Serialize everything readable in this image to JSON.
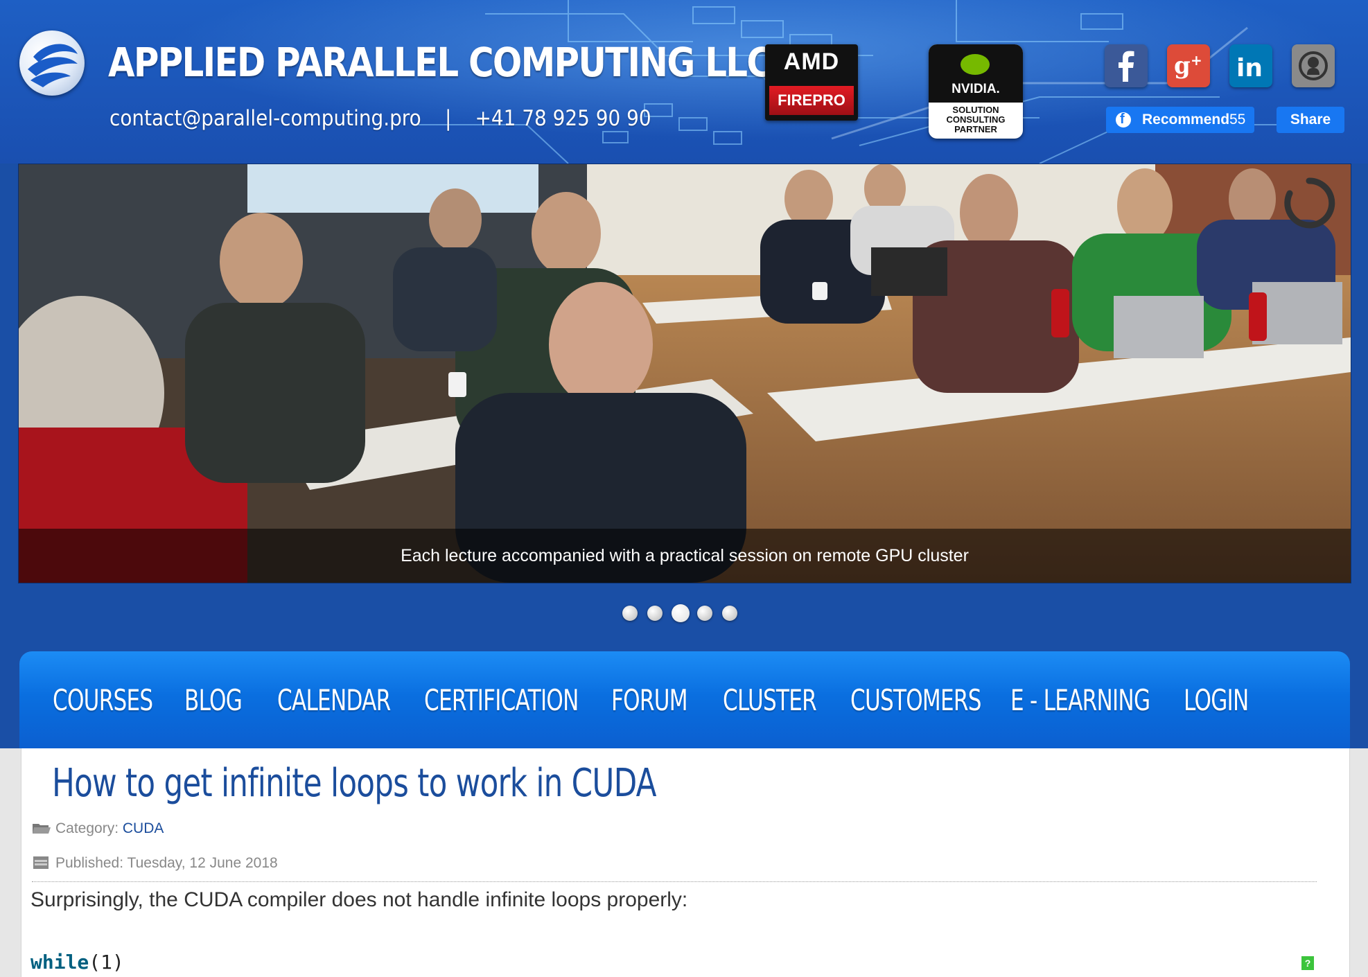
{
  "header": {
    "brand": "APPLIED PARALLEL COMPUTING LLC",
    "email": "contact@parallel-computing.pro",
    "separator": "|",
    "phone": "+41 78 925 90 90",
    "amd_logo": {
      "top": "AMD",
      "bottom": "FIREPRO"
    },
    "nvidia_logo": {
      "name": "NVIDIA.",
      "line1": "SOLUTION",
      "line2": "CONSULTING",
      "line3": "PARTNER"
    },
    "social": [
      {
        "icon": "facebook-icon",
        "color": "#3b5998"
      },
      {
        "icon": "google-plus-icon",
        "color": "#dd4b39"
      },
      {
        "icon": "linkedin-icon",
        "color": "#0077b5"
      },
      {
        "icon": "github-icon",
        "color": "#8a8a8a"
      }
    ],
    "facebook": {
      "recommend_label": "Recommend",
      "recommend_count": "55",
      "share_label": "Share"
    }
  },
  "slider": {
    "caption": "Each lecture accompanied with a practical session on remote GPU cluster",
    "dot_count": 5,
    "active_dot": 3
  },
  "nav": {
    "items": [
      "COURSES",
      "BLOG",
      "CALENDAR",
      "CERTIFICATION",
      "FORUM",
      "CLUSTER",
      "CUSTOMERS",
      "E - LEARNING",
      "LOGIN"
    ]
  },
  "article": {
    "title": "How to get infinite loops to work in CUDA",
    "category_label": "Category:",
    "category_value": "CUDA",
    "published_label": "Published:",
    "published_value": "Tuesday, 12 June 2018",
    "lead": "Surprisingly, the CUDA compiler does not handle infinite loops properly:",
    "code_keyword": "while",
    "code_rest": "(1)",
    "help_badge": "?"
  },
  "colors": {
    "header_blue": "#1e5fc4",
    "nav_blue": "#0a6fe0",
    "title_blue": "#1b4d9c",
    "facebook_blue": "#1877f2"
  }
}
